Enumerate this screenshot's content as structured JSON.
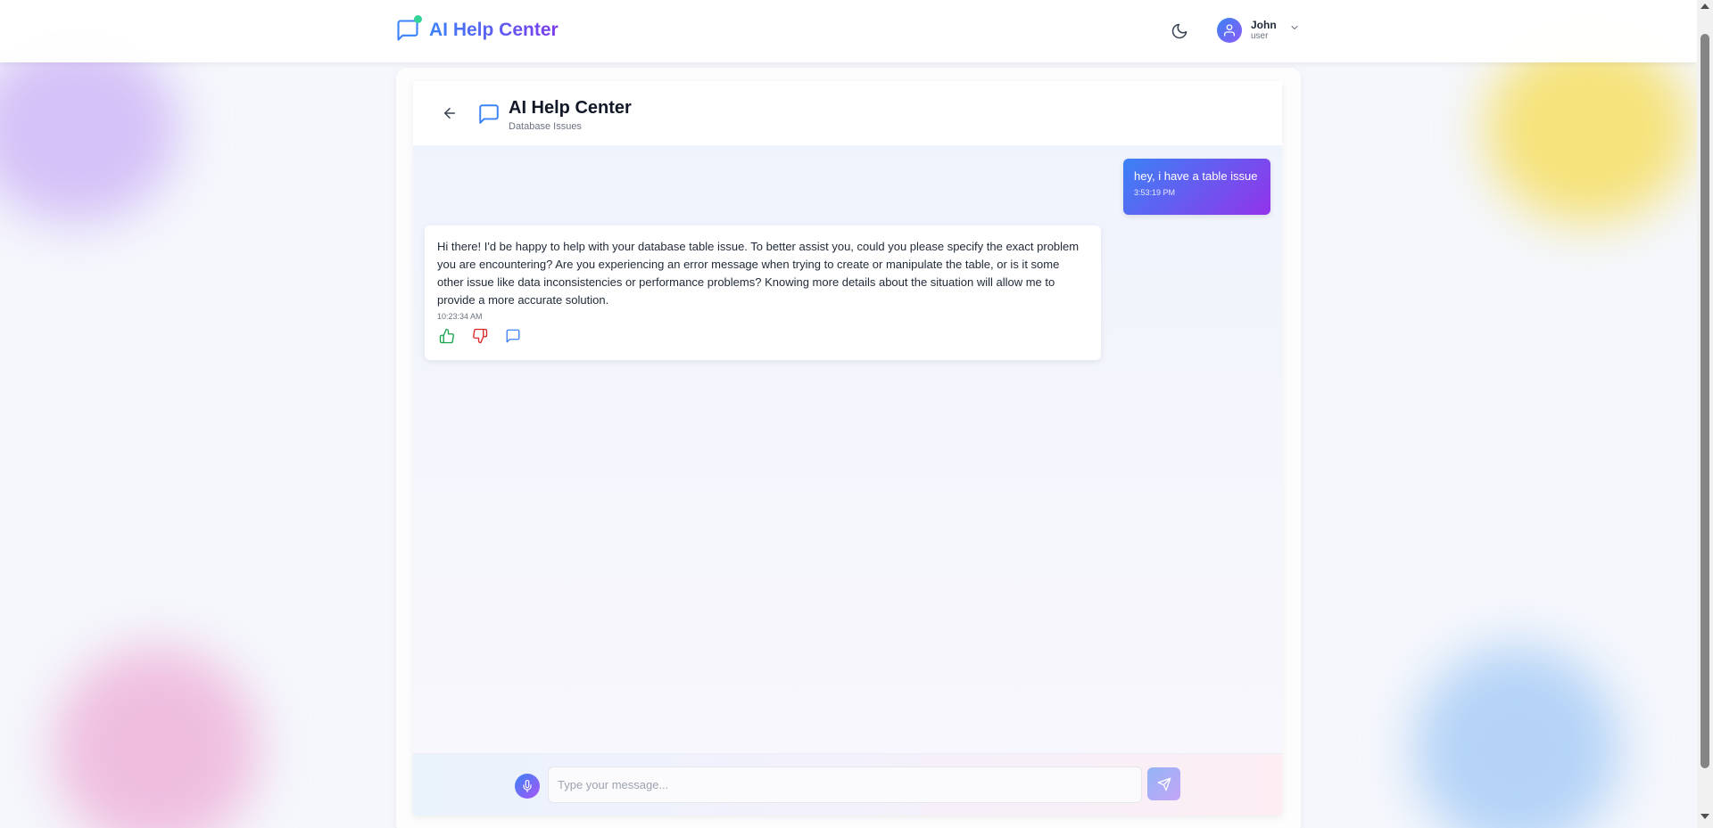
{
  "app": {
    "title": "AI Help Center"
  },
  "navbar": {
    "theme_icon": "moon-icon",
    "user": {
      "name": "John",
      "role": "user",
      "avatar_icon": "user-icon"
    }
  },
  "chat": {
    "title": "AI Help Center",
    "subtitle": "Database Issues",
    "messages": [
      {
        "sender": "user",
        "text": "hey, i have a table issue",
        "time": "3:53:19 PM"
      },
      {
        "sender": "ai",
        "text": "Hi there! I'd be happy to help with your database table issue. To better assist you, could you please specify the exact problem you are encountering? Are you experiencing an error message when trying to create or manipulate the table, or is it some other issue like data inconsistencies or performance problems? Knowing more details about the situation will allow me to provide a more accurate solution.",
        "time": "10:23:34 AM",
        "actions": [
          "thumbs-up-icon",
          "thumbs-down-icon",
          "comment-icon"
        ]
      }
    ]
  },
  "input": {
    "placeholder": "Type your message...",
    "value": ""
  },
  "colors": {
    "accent_start": "#3b82f6",
    "accent_end": "#9333ea",
    "thumbs_up": "#16a34a",
    "thumbs_down": "#dc2626",
    "comment": "#3b82f6"
  }
}
